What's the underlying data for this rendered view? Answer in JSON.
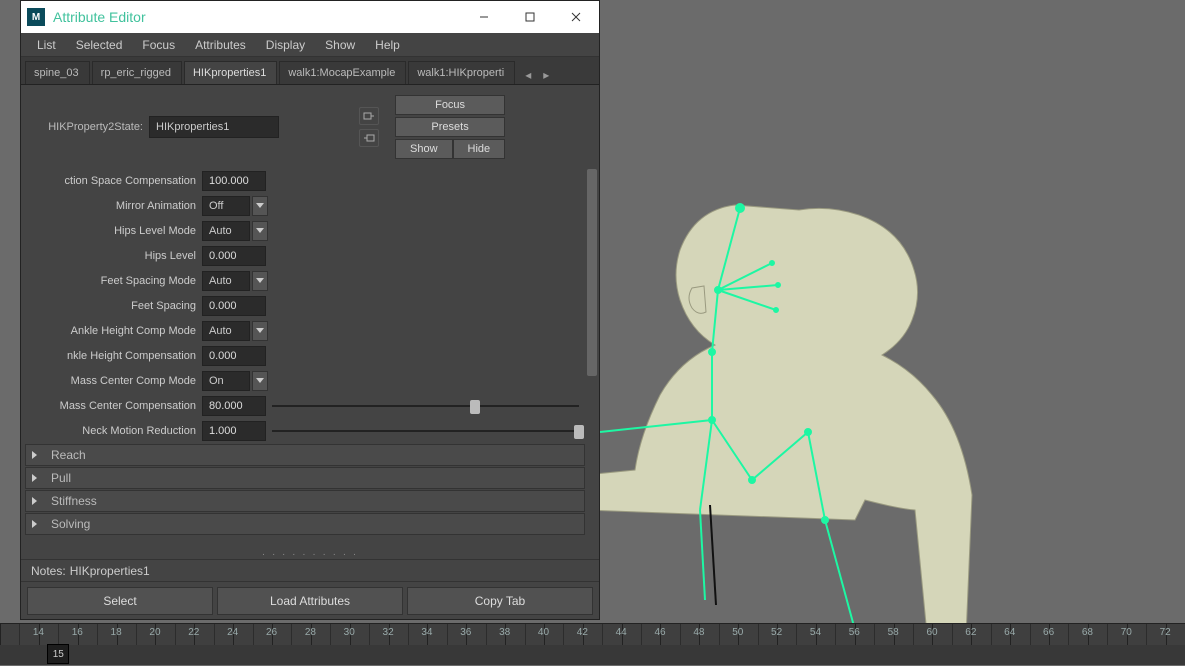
{
  "window": {
    "title": "Attribute Editor"
  },
  "menus": [
    "List",
    "Selected",
    "Focus",
    "Attributes",
    "Display",
    "Show",
    "Help"
  ],
  "tabs": [
    "spine_03",
    "rp_eric_rigged",
    "HIKproperties1",
    "walk1:MocapExample",
    "walk1:HIKproperti"
  ],
  "active_tab_index": 2,
  "header": {
    "label": "HIKProperty2State:",
    "value": "HIKproperties1",
    "buttons": {
      "focus": "Focus",
      "presets": "Presets",
      "show": "Show",
      "hide": "Hide"
    }
  },
  "attrs": [
    {
      "label": "ction Space Compensation",
      "type": "num",
      "value": "100.000"
    },
    {
      "label": "Mirror Animation",
      "type": "sel",
      "value": "Off"
    },
    {
      "label": "Hips Level Mode",
      "type": "sel",
      "value": "Auto"
    },
    {
      "label": "Hips Level",
      "type": "num",
      "value": "0.000"
    },
    {
      "label": "Feet Spacing Mode",
      "type": "sel",
      "value": "Auto"
    },
    {
      "label": "Feet Spacing",
      "type": "num",
      "value": "0.000"
    },
    {
      "label": "Ankle Height Comp Mode",
      "type": "sel",
      "value": "Auto"
    },
    {
      "label": "nkle Height Compensation",
      "type": "num",
      "value": "0.000"
    },
    {
      "label": "Mass Center Comp Mode",
      "type": "sel",
      "value": "On"
    },
    {
      "label": "Mass Center Compensation",
      "type": "numslider",
      "value": "80.000",
      "slider_pct": 66
    },
    {
      "label": "Neck Motion Reduction",
      "type": "numslider",
      "value": "1.000",
      "slider_pct": 100
    }
  ],
  "sections": [
    "Reach",
    "Pull",
    "Stiffness",
    "Solving"
  ],
  "notes": {
    "prefix": "Notes:",
    "value": "HIKproperties1"
  },
  "footer": {
    "select": "Select",
    "load": "Load Attributes",
    "copy": "Copy Tab"
  },
  "timeline": {
    "start": 12,
    "end": 73,
    "step": 2,
    "labels": [
      14,
      16,
      18,
      20,
      22,
      24,
      26,
      28,
      30,
      32,
      34,
      36,
      38,
      40,
      42,
      44,
      46,
      48,
      50,
      52,
      54,
      56,
      58,
      60,
      62,
      64,
      66,
      68,
      70,
      72
    ],
    "current": 15,
    "keyframes": []
  },
  "colors": {
    "accent": "#41c29d",
    "skeleton": "#1df7a3"
  }
}
